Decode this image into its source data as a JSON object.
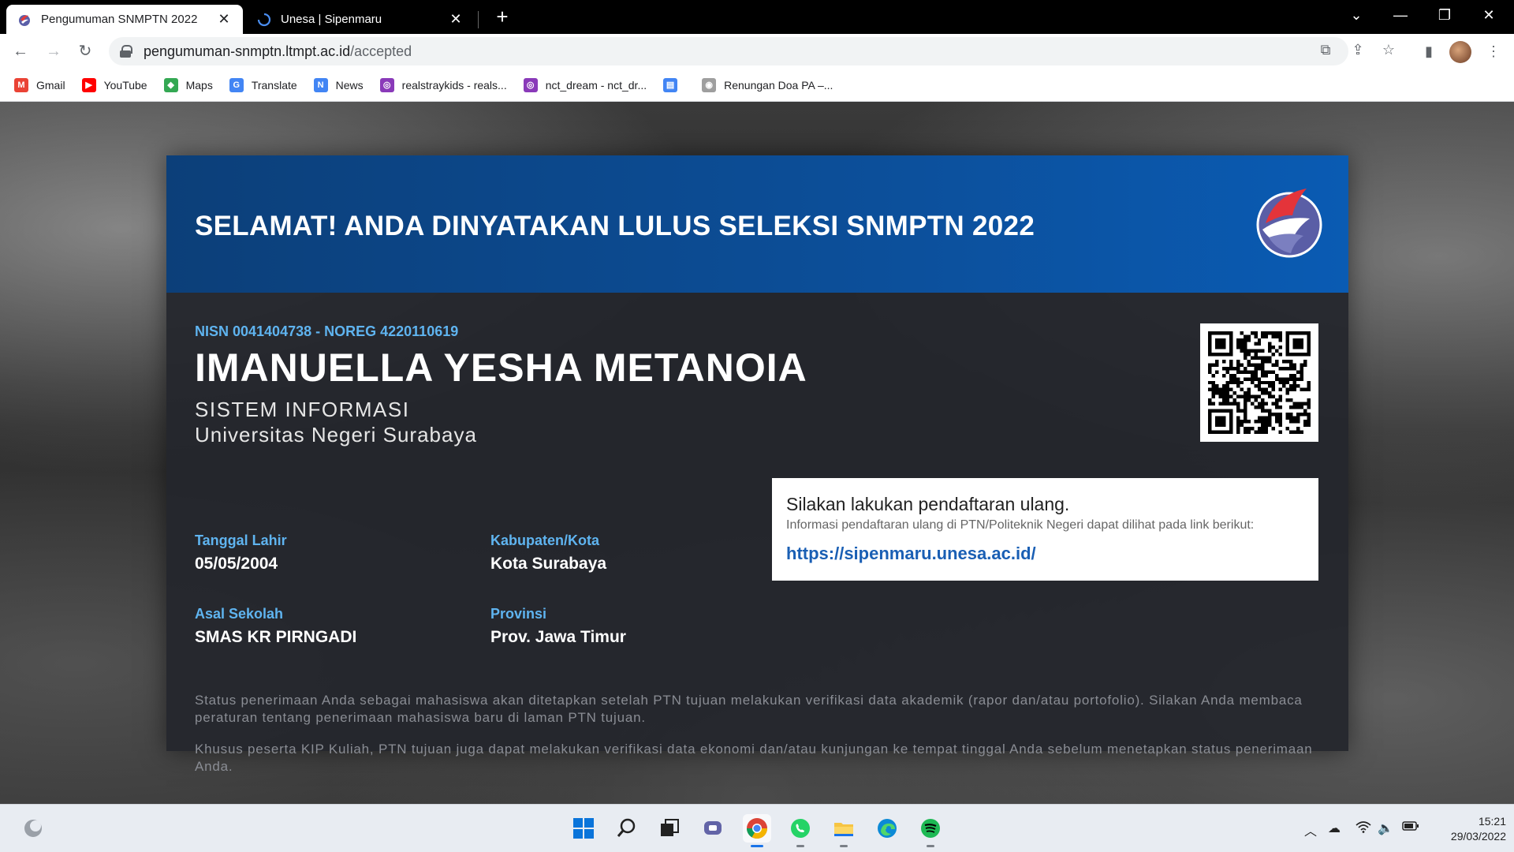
{
  "tabs": [
    {
      "title": "Pengumuman SNMPTN 2022",
      "close": "✕"
    },
    {
      "title": "Unesa | Sipenmaru",
      "close": "✕"
    }
  ],
  "new_tab": "+",
  "address": {
    "host": "pengumuman-snmptn.ltmpt.ac.id",
    "path": "/accepted"
  },
  "bookmarks": [
    {
      "label": "Gmail",
      "icon": "gmail-icon",
      "color": "#ea4335"
    },
    {
      "label": "YouTube",
      "icon": "youtube-icon",
      "color": "#ff0000"
    },
    {
      "label": "Maps",
      "icon": "maps-icon",
      "color": "#34a853"
    },
    {
      "label": "Translate",
      "icon": "translate-icon",
      "color": "#4285f4"
    },
    {
      "label": "News",
      "icon": "news-icon",
      "color": "#4285f4"
    },
    {
      "label": "realstraykids - reals...",
      "icon": "instagram-icon",
      "color": "#8a3ab9"
    },
    {
      "label": "nct_dream - nct_dr...",
      "icon": "instagram-icon",
      "color": "#8a3ab9"
    },
    {
      "label": "",
      "icon": "document-icon",
      "color": "#4285f4"
    },
    {
      "label": "Renungan Doa PA –...",
      "icon": "globe-icon",
      "color": "#9e9e9e"
    }
  ],
  "announcement": {
    "headline": "SELAMAT! ANDA DINYATAKAN LULUS SELEKSI SNMPTN 2022",
    "nisn_line": "NISN 0041404738 - NOREG 4220110619",
    "name": "IMANUELLA YESHA METANOIA",
    "program": "SISTEM INFORMASI",
    "university": "Universitas Negeri Surabaya",
    "fields": {
      "birth_label": "Tanggal Lahir",
      "birth_value": "05/05/2004",
      "city_label": "Kabupaten/Kota",
      "city_value": "Kota Surabaya",
      "school_label": "Asal Sekolah",
      "school_value": "SMAS KR PIRNGADI",
      "province_label": "Provinsi",
      "province_value": "Prov. Jawa Timur"
    },
    "registration": {
      "title": "Silakan lakukan pendaftaran ulang.",
      "desc": "Informasi pendaftaran ulang di PTN/Politeknik Negeri dapat dilihat pada link berikut:",
      "link": "https://sipenmaru.unesa.ac.id/"
    },
    "note1": "Status penerimaan Anda sebagai mahasiswa akan ditetapkan setelah PTN tujuan melakukan verifikasi data akademik (rapor dan/atau portofolio). Silakan Anda membaca peraturan tentang penerimaan mahasiswa baru di laman PTN tujuan.",
    "note2": "Khusus peserta KIP Kuliah, PTN tujuan juga dapat melakukan verifikasi data ekonomi dan/atau kunjungan ke tempat tinggal Anda sebelum menetapkan status penerimaan Anda."
  },
  "clock": {
    "time": "15:21",
    "date": "29/03/2022"
  },
  "colors": {
    "header_blue": "#0c4f9a",
    "label_blue": "#5fb4f0",
    "link_blue": "#1a5fb4"
  }
}
